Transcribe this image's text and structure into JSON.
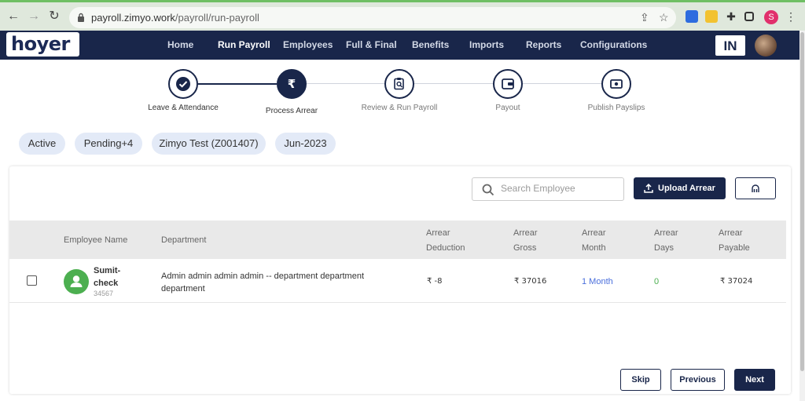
{
  "browser": {
    "url_host": "payroll.zimyo.work",
    "url_path": "/payroll/run-payroll",
    "profile_letter": "S"
  },
  "app": {
    "logo": "hoyer",
    "nav": [
      "Home",
      "Run Payroll",
      "Employees",
      "Full & Final",
      "Benefits",
      "Imports",
      "Reports",
      "Configurations"
    ],
    "active_nav": "Run Payroll",
    "country_badge": "IN"
  },
  "stepper": {
    "steps": [
      {
        "label": "Leave & Attendance",
        "icon": "check-icon",
        "state": "done"
      },
      {
        "label": "Process Arrear",
        "icon": "rupee-icon",
        "state": "current"
      },
      {
        "label": "Review & Run Payroll",
        "icon": "clipboard-search-icon",
        "state": "pending"
      },
      {
        "label": "Payout",
        "icon": "wallet-icon",
        "state": "pending"
      },
      {
        "label": "Publish Payslips",
        "icon": "money-icon",
        "state": "pending"
      }
    ]
  },
  "filters": {
    "chips": [
      "Active",
      "Pending+4",
      "Zimyo Test (Z001407)",
      "Jun-2023"
    ]
  },
  "toolbar": {
    "search_placeholder": "Search Employee",
    "upload_label": "Upload Arrear"
  },
  "table": {
    "columns": {
      "employee_name": "Employee Name",
      "department": "Department",
      "arrear_deduction": [
        "Arrear",
        "Deduction"
      ],
      "arrear_gross": [
        "Arrear",
        "Gross"
      ],
      "arrear_month": [
        "Arrear",
        "Month"
      ],
      "arrear_days": [
        "Arrear",
        "Days"
      ],
      "arrear_payable": [
        "Arrear",
        "Payable"
      ]
    },
    "rows": [
      {
        "name_line1": "Sumit-",
        "name_line2": "check",
        "employee_id": "34567",
        "department_line1": "Admin admin admin admin -- department department",
        "department_line2": "department",
        "arrear_deduction": "₹ -8",
        "arrear_gross": "₹ 37016",
        "arrear_month": "1 Month",
        "arrear_days": "0",
        "arrear_payable": "₹ 37024"
      }
    ]
  },
  "footer": {
    "skip": "Skip",
    "previous": "Previous",
    "next": "Next"
  },
  "colors": {
    "primary": "#19264a",
    "chip_bg": "#e3eaf7",
    "link_blue": "#4a6fdc",
    "success_green": "#4caf50"
  }
}
